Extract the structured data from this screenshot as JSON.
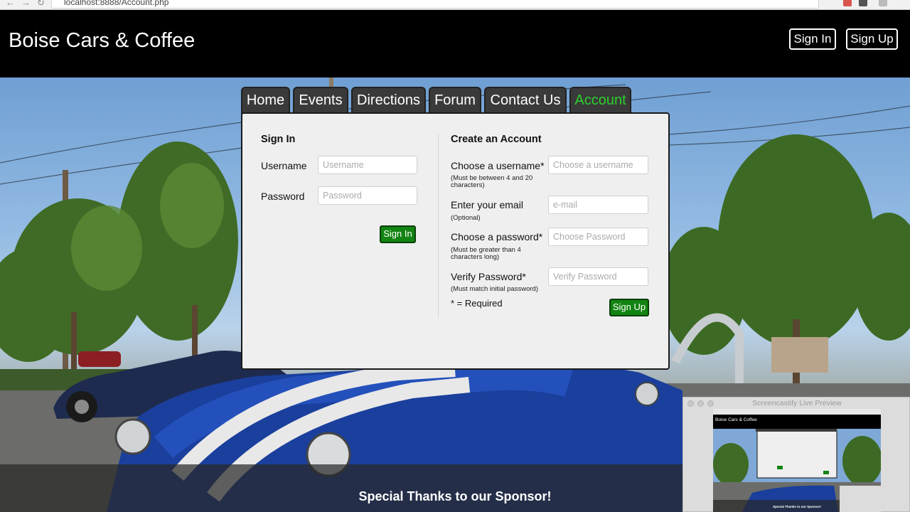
{
  "browser": {
    "url": "localhost:8888/Account.php"
  },
  "header": {
    "title": "Boise Cars & Coffee",
    "signin_label": "Sign In",
    "signup_label": "Sign Up"
  },
  "tabs": [
    {
      "label": "Home"
    },
    {
      "label": "Events"
    },
    {
      "label": "Directions"
    },
    {
      "label": "Forum"
    },
    {
      "label": "Contact Us"
    },
    {
      "label": "Account",
      "active": true
    }
  ],
  "signin": {
    "title": "Sign In",
    "username_label": "Username",
    "username_placeholder": "Username",
    "password_label": "Password",
    "password_placeholder": "Password",
    "button": "Sign In"
  },
  "create": {
    "title": "Create an Account",
    "username_label": "Choose a username*",
    "username_hint": "(Must be between 4 and 20 characters)",
    "username_placeholder": "Choose a username",
    "email_label": "Enter your email",
    "email_hint": "(Optional)",
    "email_placeholder": "e-mail",
    "password_label": "Choose a password*",
    "password_hint": "(Must be greater than 4 characters long)",
    "password_placeholder": "Choose Password",
    "verify_label": "Verify Password*",
    "verify_hint": "(Must match initial password)",
    "verify_placeholder": "Verify Password",
    "required_note": "* = Required",
    "button": "Sign Up"
  },
  "footer": {
    "text": "Special Thanks to our Sponsor!"
  },
  "preview": {
    "title": "Screencastify Live Preview",
    "mini_title": "Boise Cars & Coffee",
    "mini_footer": "Special Thanks to our Sponsor!"
  },
  "colors": {
    "header_bg": "#000000",
    "active_tab": "#2bd12b",
    "button_green": "#128412",
    "panel_bg": "#efefef"
  }
}
